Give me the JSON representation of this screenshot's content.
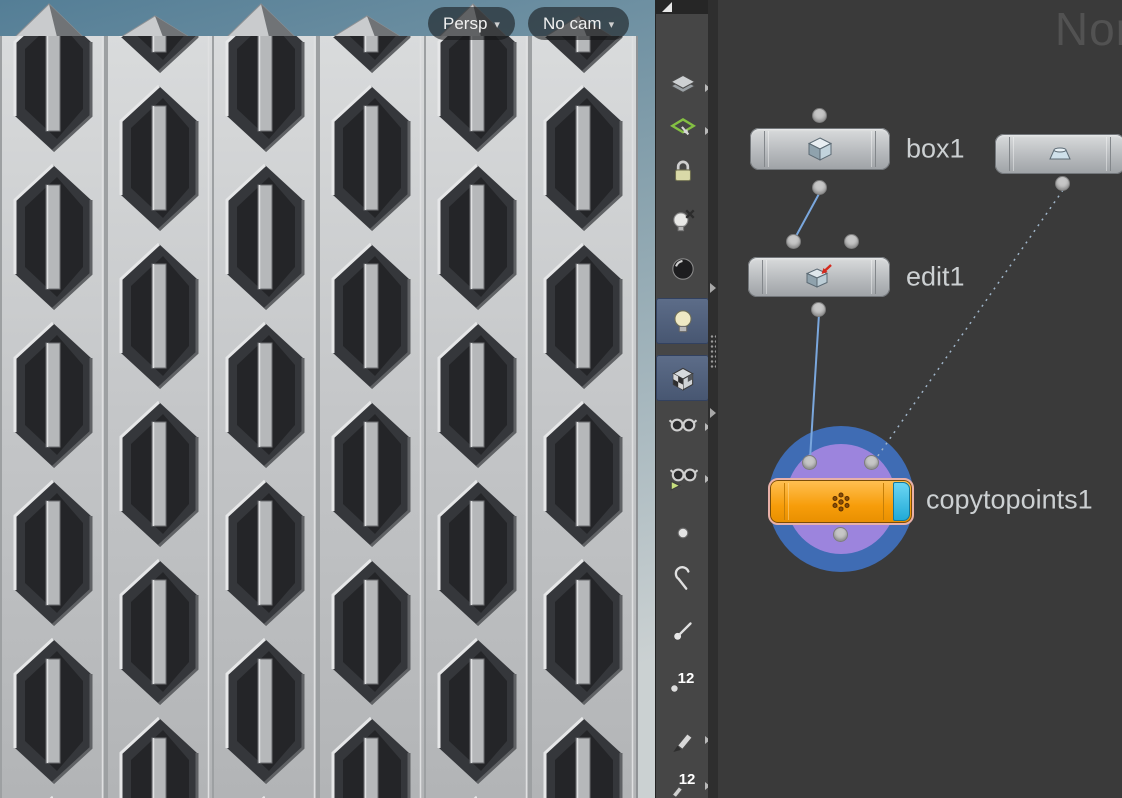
{
  "viewport": {
    "persp": {
      "label": "Persp",
      "caret": "▾"
    },
    "cam": {
      "label": "No cam",
      "caret": "▾"
    }
  },
  "toolbar": {
    "icons": [
      "expand-arrow",
      "reference-planes",
      "construction-plane",
      "lock",
      "lights-off",
      "headlight",
      "lights-normal",
      "high-quality-shading",
      "smooth-glasses",
      "ghost-glasses",
      "display-points",
      "display-hooks",
      "display-normals",
      "point-numbers",
      "display-markers",
      "primitive-numbers"
    ],
    "point_numbers_label": "12",
    "primitive_numbers_label": "12"
  },
  "network": {
    "watermark": "Nor",
    "nodes": {
      "box": {
        "label": "box1"
      },
      "edit": {
        "label": "edit1"
      },
      "copy": {
        "label": "copytopoints1"
      }
    },
    "colors": {
      "selected_ring_outer": "#3f6cb4",
      "selected_ring_inner": "#9c84dd",
      "copy_body_orange": "#f79d0a",
      "copy_cap_cyan": "#2fc0ea",
      "wire": "#7aa7dd"
    }
  }
}
